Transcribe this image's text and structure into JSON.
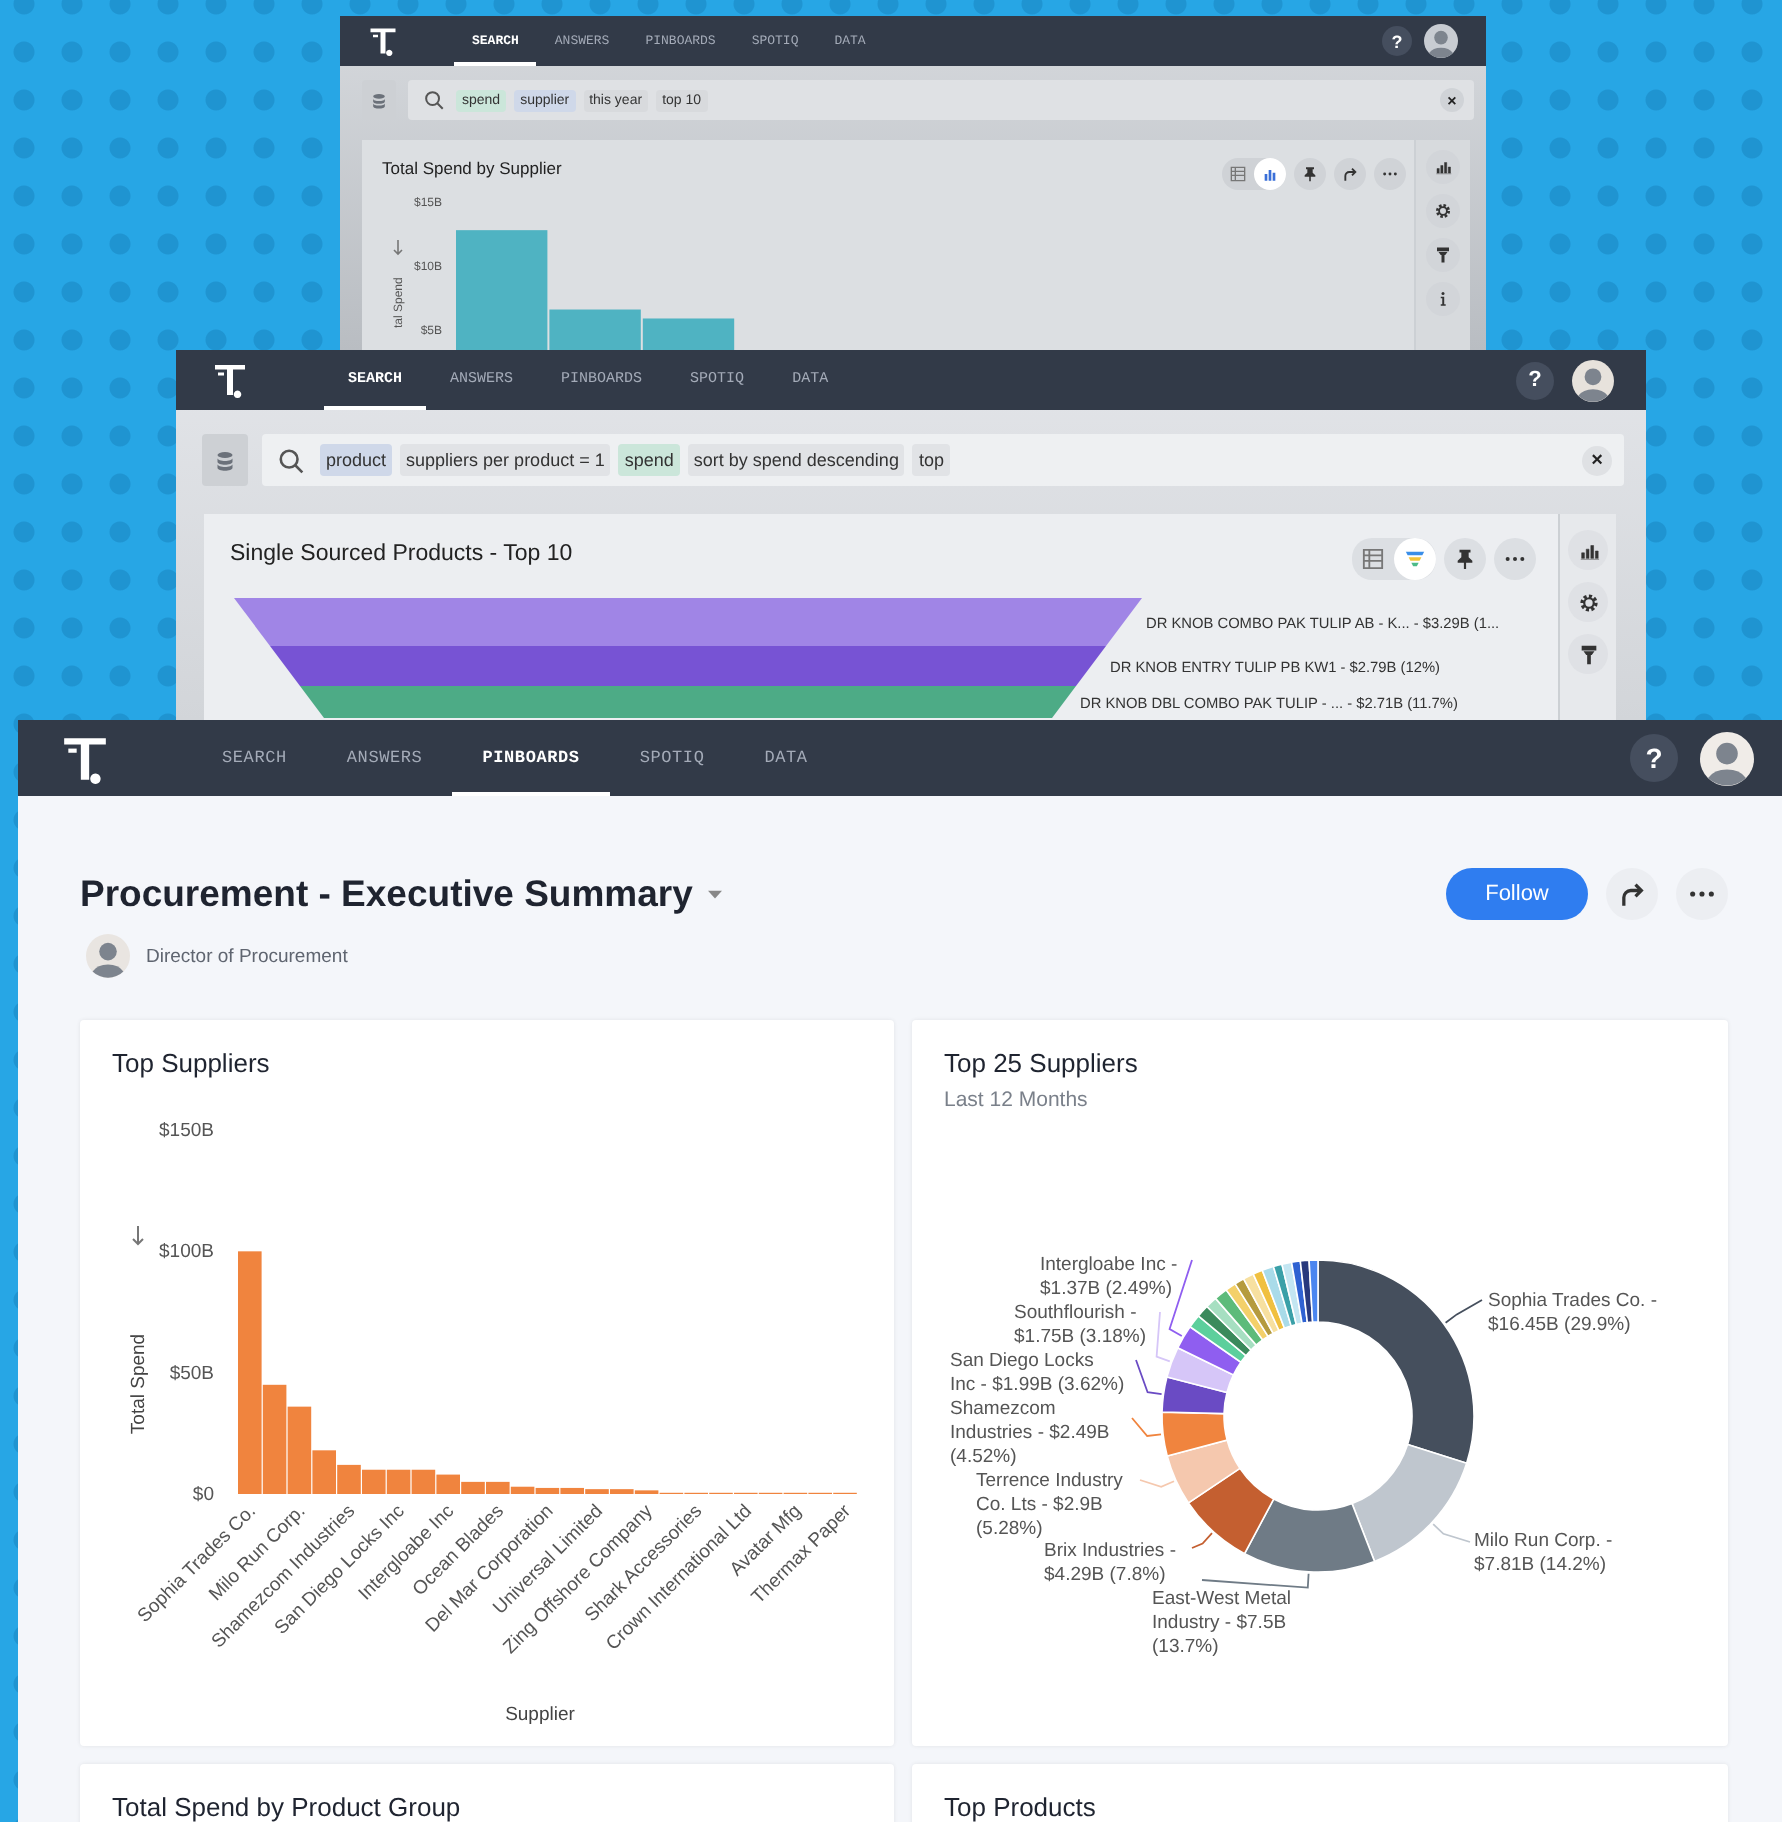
{
  "back_window": {
    "nav_tabs": [
      {
        "label": "SEARCH",
        "selected": true
      },
      {
        "label": "ANSWERS",
        "selected": false
      },
      {
        "label": "PINBOARDS",
        "selected": false
      },
      {
        "label": "SPOTIQ",
        "selected": false
      },
      {
        "label": "DATA",
        "selected": false
      }
    ],
    "help": "?",
    "search_tokens": [
      {
        "text": "spend",
        "kind": "measure"
      },
      {
        "text": "supplier",
        "kind": "attribute"
      },
      {
        "text": "this year",
        "kind": "keyword"
      },
      {
        "text": "top 10",
        "kind": "keyword"
      }
    ],
    "clear": "×",
    "chart_title": "Total Spend by Supplier",
    "view_toggle": [
      {
        "kind": "table",
        "selected": false
      },
      {
        "kind": "chart",
        "selected": true
      }
    ],
    "chart_axis_title": "tal Spend",
    "chart_axis_labels": [
      "$15B",
      "$10B",
      "$5B"
    ]
  },
  "middle_window": {
    "nav_tabs": [
      {
        "label": "SEARCH",
        "selected": true
      },
      {
        "label": "ANSWERS",
        "selected": false
      },
      {
        "label": "PINBOARDS",
        "selected": false
      },
      {
        "label": "SPOTIQ",
        "selected": false
      },
      {
        "label": "DATA",
        "selected": false
      }
    ],
    "help": "?",
    "search_tokens": [
      {
        "text": "product",
        "kind": "attribute"
      },
      {
        "text": "suppliers per product = 1",
        "kind": "keyword"
      },
      {
        "text": "spend",
        "kind": "measure"
      },
      {
        "text": "sort by spend descending",
        "kind": "keyword"
      },
      {
        "text": "top",
        "kind": "keyword"
      }
    ],
    "clear": "×",
    "chart_title": "Single Sourced Products - Top 10",
    "view_toggle": [
      {
        "kind": "table",
        "selected": false
      },
      {
        "kind": "funnel",
        "selected": true
      }
    ],
    "funnel_bands": [
      {
        "label": "DR KNOB COMBO PAK TULIP AB - K... - $3.29B (1...",
        "color": "#a085e6"
      },
      {
        "label": "DR KNOB ENTRY TULIP PB KW1 - $2.79B (12%)",
        "color": "#7753d4"
      },
      {
        "label": "DR KNOB DBL COMBO PAK TULIP - ... - $2.71B (11.7%)",
        "color": "#4dab86"
      }
    ]
  },
  "front_window": {
    "nav_tabs": [
      {
        "label": "SEARCH",
        "selected": false
      },
      {
        "label": "ANSWERS",
        "selected": false
      },
      {
        "label": "PINBOARDS",
        "selected": true
      },
      {
        "label": "SPOTIQ",
        "selected": false
      },
      {
        "label": "DATA",
        "selected": false
      }
    ],
    "help": "?",
    "title": "Procurement - Executive Summary",
    "author_role": "Director of Procurement",
    "follow_button": "Follow",
    "cards": [
      {
        "title": "Top Suppliers",
        "chart_data": {
          "type": "bar",
          "xlabel": "Supplier",
          "ylabel": "Total Spend",
          "ylim": [
            0,
            150
          ],
          "categories": [
            "Sophia Trades Co.",
            null,
            "Milo Run Corp.",
            null,
            "Shamezcom Industries",
            null,
            "San Diego Locks Inc",
            null,
            "Intergloabe Inc",
            null,
            "Ocean Blades",
            null,
            "Del Mar Corporation",
            null,
            "Universal Limited",
            null,
            "Zing Offshore Company",
            null,
            "Shark Accessories",
            null,
            "Crown International Ltd",
            null,
            "Avatar Mfg",
            null,
            "Thermax Paper"
          ],
          "series": [
            {
              "color": "#f0843e",
              "values": [
                100,
                45,
                36,
                18,
                12,
                10,
                10,
                10,
                8,
                5,
                5,
                3,
                2.5,
                2.5,
                2,
                2,
                1.5,
                0.5,
                0.5,
                0.5,
                0.5,
                0.5,
                0.5,
                0.5,
                0.5
              ]
            }
          ],
          "yticks": [
            {
              "value": 0,
              "label": "$0"
            },
            {
              "value": 50,
              "label": "$50B"
            },
            {
              "value": 100,
              "label": "$100B"
            },
            {
              "value": 150,
              "label": "$150B"
            }
          ]
        }
      },
      {
        "title": "Top 25 Suppliers",
        "subtitle": "Last 12 Months",
        "chart_data": {
          "type": "donut",
          "values": [
            29.9,
            14.2,
            13.7,
            7.8,
            5.28,
            4.52,
            3.62,
            3.18,
            2.49,
            1.4,
            1.3,
            1.2,
            1.4,
            1.1,
            1.0,
            1.1,
            1.0,
            1.2,
            0.9,
            1.0,
            0.9,
            0.9,
            0.91
          ],
          "colors": [
            "#454f5d",
            "#bfc6ce",
            "#6f7b86",
            "#c45f30",
            "#f5c8ae",
            "#f0843e",
            "#6a4bc4",
            "#d6c6f8",
            "#8f5ef0",
            "#5ccf9c",
            "#3b8a5c",
            "#a6dfc1",
            "#5dbb7a",
            "#f3d06a",
            "#b59b3e",
            "#f7e0a0",
            "#f0c040",
            "#a9dbe9",
            "#3aa0a8",
            "#c3e6f2",
            "#2f62d2",
            "#28397d",
            "#4b86f0"
          ]
        },
        "slice_labels": [
          {
            "lines": [
              "Intergloabe Inc -",
              "$1.37B (2.49%)"
            ]
          },
          {
            "lines": [
              "Sophia Trades Co. -",
              "$16.45B (29.9%)"
            ]
          },
          {
            "lines": [
              "Southflourish -",
              "$1.75B (3.18%)"
            ]
          },
          {
            "lines": [
              "San Diego Locks",
              "Inc - $1.99B (3.62%)"
            ]
          },
          {
            "lines": [
              "Shamezcom",
              "Industries - $2.49B",
              "(4.52%)"
            ]
          },
          {
            "lines": [
              "Terrence Industry",
              "Co. Lts - $2.9B",
              "(5.28%)"
            ]
          },
          {
            "lines": [
              "Milo Run Corp. -",
              "$7.81B (14.2%)"
            ]
          },
          {
            "lines": [
              "Brix Industries -",
              "$4.29B (7.8%)"
            ]
          },
          {
            "lines": [
              "East-West Metal",
              "Industry - $7.5B",
              "(13.7%)"
            ]
          }
        ]
      },
      {
        "title": "Total Spend by Product Group"
      },
      {
        "title": "Top Products"
      }
    ]
  }
}
